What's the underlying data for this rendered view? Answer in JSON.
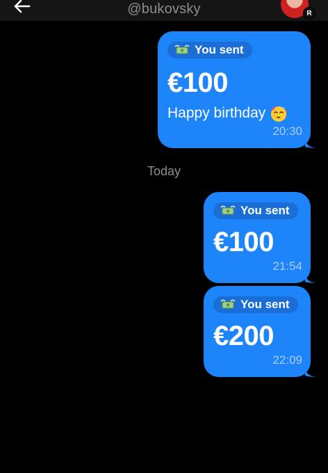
{
  "header": {
    "handle": "@bukovsky",
    "avatar_badge": "R",
    "back_icon": "arrow-left-icon"
  },
  "messages": [
    {
      "pill_label": "You sent",
      "amount": "€100",
      "note": "Happy birthday",
      "note_emoji": "face-with-party-horn-emoji",
      "time": "20:30"
    },
    {
      "pill_label": "You sent",
      "amount": "€100",
      "time": "21:54"
    },
    {
      "pill_label": "You sent",
      "amount": "€200",
      "time": "22:09"
    }
  ],
  "separator": {
    "label": "Today"
  },
  "colors": {
    "background": "#000000",
    "bubble": "#1d84fa",
    "pill": "#1a6ed6",
    "timestamp": "#a9cffb",
    "muted_text": "#8e8e93"
  },
  "icons": {
    "money": "money-with-wings-icon"
  }
}
